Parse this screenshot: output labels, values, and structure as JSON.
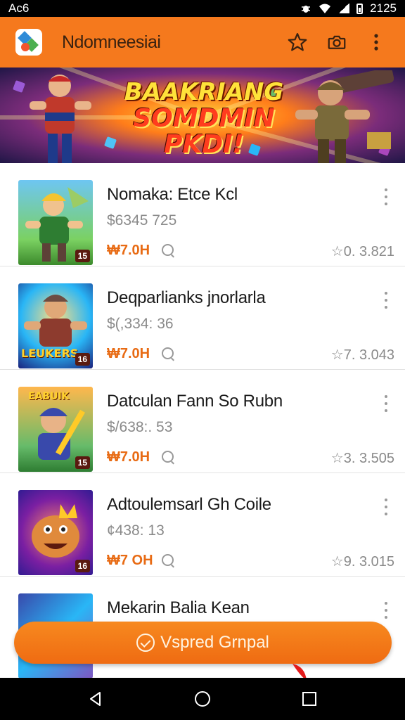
{
  "status_bar": {
    "time_left": "Aᴄ6",
    "time_right": "2125"
  },
  "app_bar": {
    "title": "Ndomneesiai",
    "icons": [
      "app-logo-icon",
      "star-icon",
      "camera-icon",
      "more-vert-icon"
    ]
  },
  "banner": {
    "line1": "BAAKRIANG",
    "line2": "SOMDMIN PKDI!"
  },
  "games": [
    {
      "title": "Nomaka: Etce Kcl",
      "subtitle": "$6345 725",
      "price": "₩7.0H",
      "rating": "☆0. 3.821",
      "tag": "15"
    },
    {
      "title": "Deqparlianks jnorlarla",
      "subtitle": "$(,334: 36",
      "price": "₩7.0H",
      "rating": "☆7. 3.043",
      "tag": "16",
      "thumb_word": "LEUKERS"
    },
    {
      "title": "Datculan Fann So Rubn",
      "subtitle": "$/638:. 53",
      "price": "₩7.0H",
      "rating": "☆3. 3.505",
      "tag": "15",
      "thumb_word": "EABUIK"
    },
    {
      "title": "Adtoulemsarl Gh Coile",
      "subtitle": "¢438: 13",
      "price": "₩7 OH",
      "rating": "☆9. 3.015",
      "tag": "16"
    },
    {
      "title": "Mekarin Balia Kean"
    }
  ],
  "action_button": {
    "label": "Vspred Grnpal"
  },
  "colors": {
    "accent": "#f5791d",
    "price": "#e86b14",
    "text_primary": "#1a1a1a",
    "text_secondary": "#8a8a8a"
  }
}
